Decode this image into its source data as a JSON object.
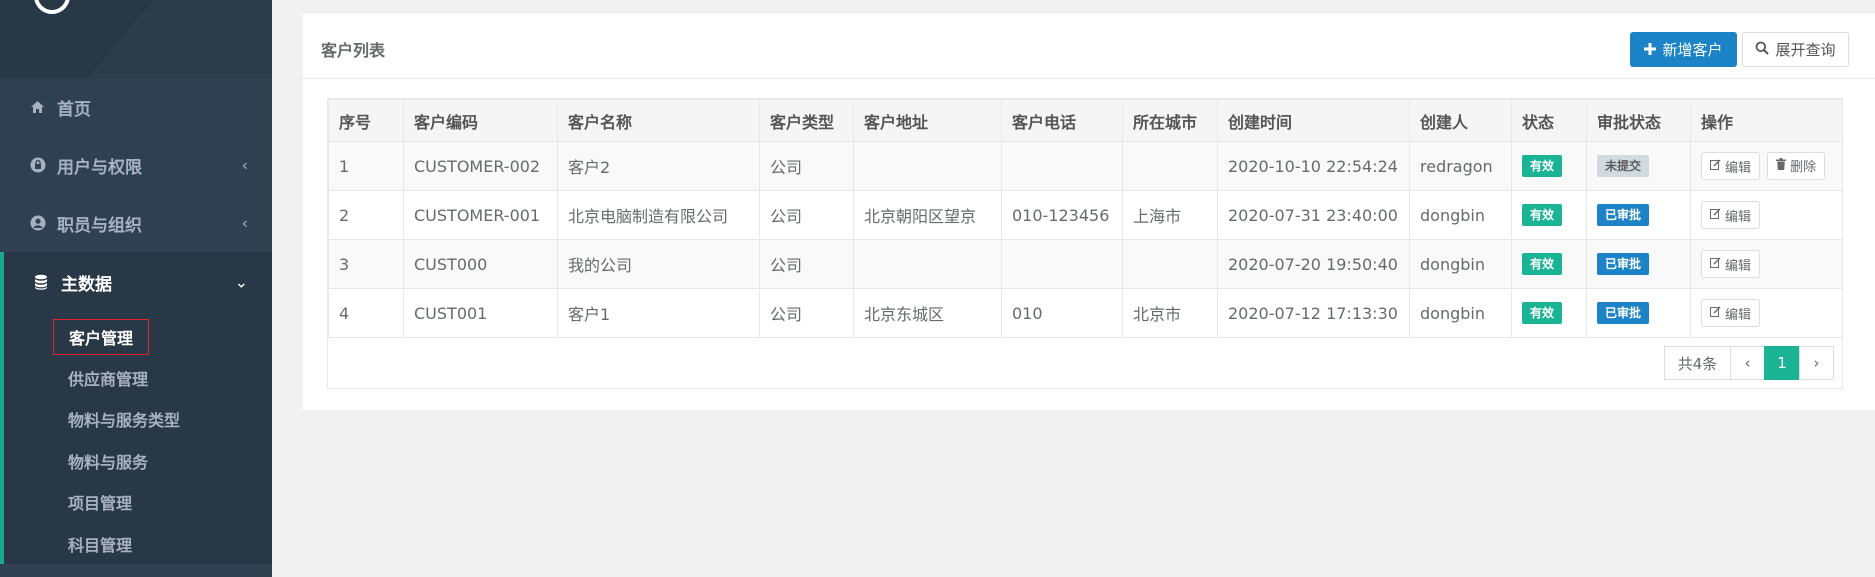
{
  "sidebar": {
    "menu": [
      {
        "label": "首页",
        "icon": "home-icon"
      },
      {
        "label": "用户与权限",
        "icon": "lock-icon"
      },
      {
        "label": "职员与组织",
        "icon": "user-circle-icon"
      },
      {
        "label": "主数据",
        "icon": "database-icon"
      }
    ],
    "submenu": [
      "客户管理",
      "供应商管理",
      "物料与服务类型",
      "物料与服务",
      "项目管理",
      "科目管理"
    ],
    "chevron_left": "‹",
    "chevron_down": "⌄"
  },
  "card": {
    "title": "客户列表",
    "add_button": "新增客户",
    "query_button": "展开查询"
  },
  "table": {
    "headers": [
      "序号",
      "客户编码",
      "客户名称",
      "客户类型",
      "客户地址",
      "客户电话",
      "所在城市",
      "创建时间",
      "创建人",
      "状态",
      "审批状态",
      "操作"
    ],
    "rows": [
      {
        "no": "1",
        "code": "CUSTOMER-002",
        "name": "客户2",
        "type": "公司",
        "address": "",
        "phone": "",
        "city": "",
        "created": "2020-10-10 22:54:24",
        "creator": "redragon",
        "status": "有效",
        "approval": "未提交",
        "edit": "编辑",
        "delete": "删除"
      },
      {
        "no": "2",
        "code": "CUSTOMER-001",
        "name": "北京电脑制造有限公司",
        "type": "公司",
        "address": "北京朝阳区望京",
        "phone": "010-123456",
        "city": "上海市",
        "created": "2020-07-31 23:40:00",
        "creator": "dongbin",
        "status": "有效",
        "approval": "已审批",
        "edit": "编辑"
      },
      {
        "no": "3",
        "code": "CUST000",
        "name": "我的公司",
        "type": "公司",
        "address": "",
        "phone": "",
        "city": "",
        "created": "2020-07-20 19:50:40",
        "creator": "dongbin",
        "status": "有效",
        "approval": "已审批",
        "edit": "编辑"
      },
      {
        "no": "4",
        "code": "CUST001",
        "name": "客户1",
        "type": "公司",
        "address": "北京东城区",
        "phone": "010",
        "city": "北京市",
        "created": "2020-07-12 17:13:30",
        "creator": "dongbin",
        "status": "有效",
        "approval": "已审批",
        "edit": "编辑"
      }
    ]
  },
  "pagination": {
    "total": "共4条",
    "prev": "‹",
    "current": "1",
    "next": "›"
  },
  "colors": {
    "sidebar_bg": "#2f4050",
    "accent_green": "#1ab394",
    "primary_blue": "#1c84c6",
    "highlight_red": "#e5232b"
  }
}
